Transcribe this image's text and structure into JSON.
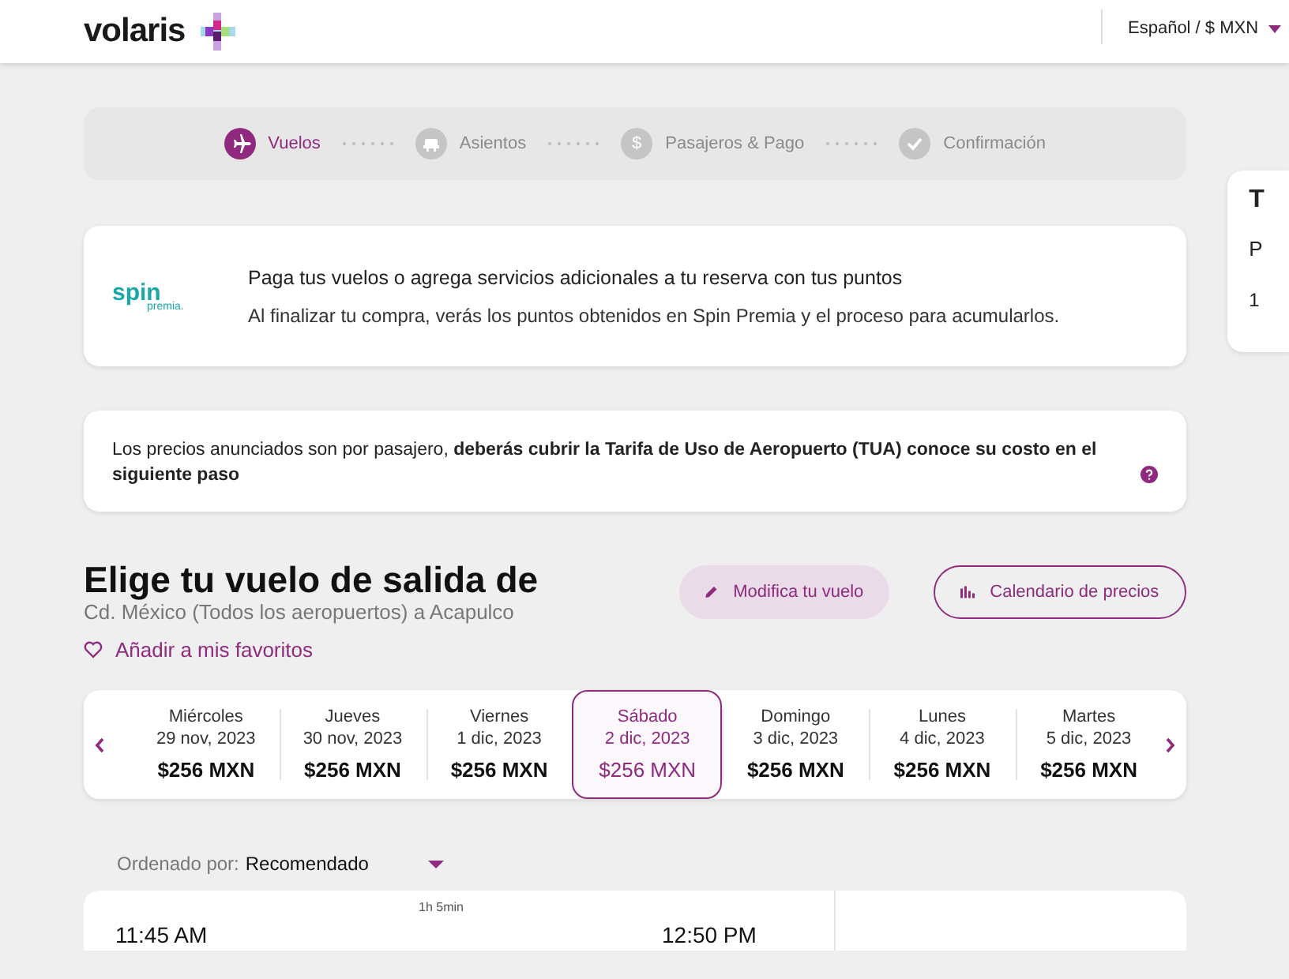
{
  "header": {
    "logo": "volaris",
    "language": "Español / $ MXN"
  },
  "steps": [
    {
      "kind": "plane",
      "label": "Vuelos",
      "selected": true
    },
    {
      "kind": "seat",
      "label": "Asientos",
      "selected": false
    },
    {
      "kind": "dollar",
      "symbol": "$",
      "label": "Pasajeros & Pago",
      "selected": false
    },
    {
      "kind": "check",
      "label": "Confirmación",
      "selected": false
    }
  ],
  "points_card": {
    "logo_main": "spin",
    "logo_sub": "premia.",
    "title": "Paga tus vuelos o agrega servicios adicionales a tu reserva con tus puntos",
    "text": "Al finalizar tu compra, verás los puntos obtenidos en Spin Premia y el proceso para acumularlos."
  },
  "fare_notice": {
    "text": "Los precios anunciados son por pasajero, **deberás cubrir la Tarifa de Uso de Aeropuerto (TUA) conoce su costo en el siguiente paso**"
  },
  "flight_heading": {
    "title": "Elige tu vuelo de salida de",
    "route": "Cd. México (Todos los aeropuertos) a Acapulco",
    "favorite": "Añadir a mis favoritos",
    "modify_button": "Modifica tu vuelo",
    "calendar_button": "Calendario de precios"
  },
  "dates": [
    {
      "day": "Miércoles",
      "date": "29 nov, 2023",
      "price": "$256 MXN",
      "selected": false
    },
    {
      "day": "Jueves",
      "date": "30 nov, 2023",
      "price": "$256 MXN",
      "selected": false
    },
    {
      "day": "Viernes",
      "date": "1 dic, 2023",
      "price": "$256 MXN",
      "selected": false
    },
    {
      "day": "Sábado",
      "date": "2 dic, 2023",
      "price": "$256 MXN",
      "selected": true
    },
    {
      "day": "Domingo",
      "date": "3 dic, 2023",
      "price": "$256 MXN",
      "selected": false
    },
    {
      "day": "Lunes",
      "date": "4 dic, 2023",
      "price": "$256 MXN",
      "selected": false
    },
    {
      "day": "Martes",
      "date": "5 dic, 2023",
      "price": "$256 MXN",
      "selected": false
    }
  ],
  "sort": {
    "label": "Ordenado por:",
    "value": "Recomendado"
  },
  "flight": {
    "departure": "11:45 AM",
    "duration": "1h 5min",
    "arrival": "12:50 PM"
  },
  "side_panel": {
    "line_1": "T",
    "line_2": "P",
    "line_3": "1"
  }
}
